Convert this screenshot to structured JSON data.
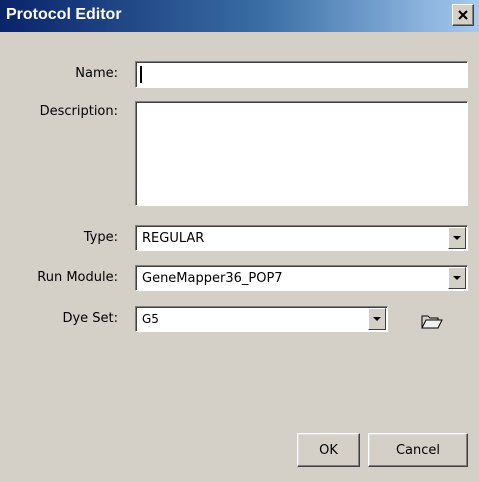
{
  "window": {
    "title": "Protocol Editor",
    "close_icon": "close-icon"
  },
  "form": {
    "name_label": "Name:",
    "name_value": "",
    "description_label": "Description:",
    "description_value": "",
    "type_label": "Type:",
    "type_value": "REGULAR",
    "run_module_label": "Run Module:",
    "run_module_value": "GeneMapper36_POP7",
    "dye_set_label": "Dye Set:",
    "dye_set_value": "G5",
    "dye_set_browse_icon": "folder-open-icon"
  },
  "buttons": {
    "ok_label": "OK",
    "cancel_label": "Cancel"
  },
  "colors": {
    "title_gradient_start": "#0a246a",
    "title_gradient_end": "#a6caf0",
    "dialog_background": "#d4d0c8"
  }
}
